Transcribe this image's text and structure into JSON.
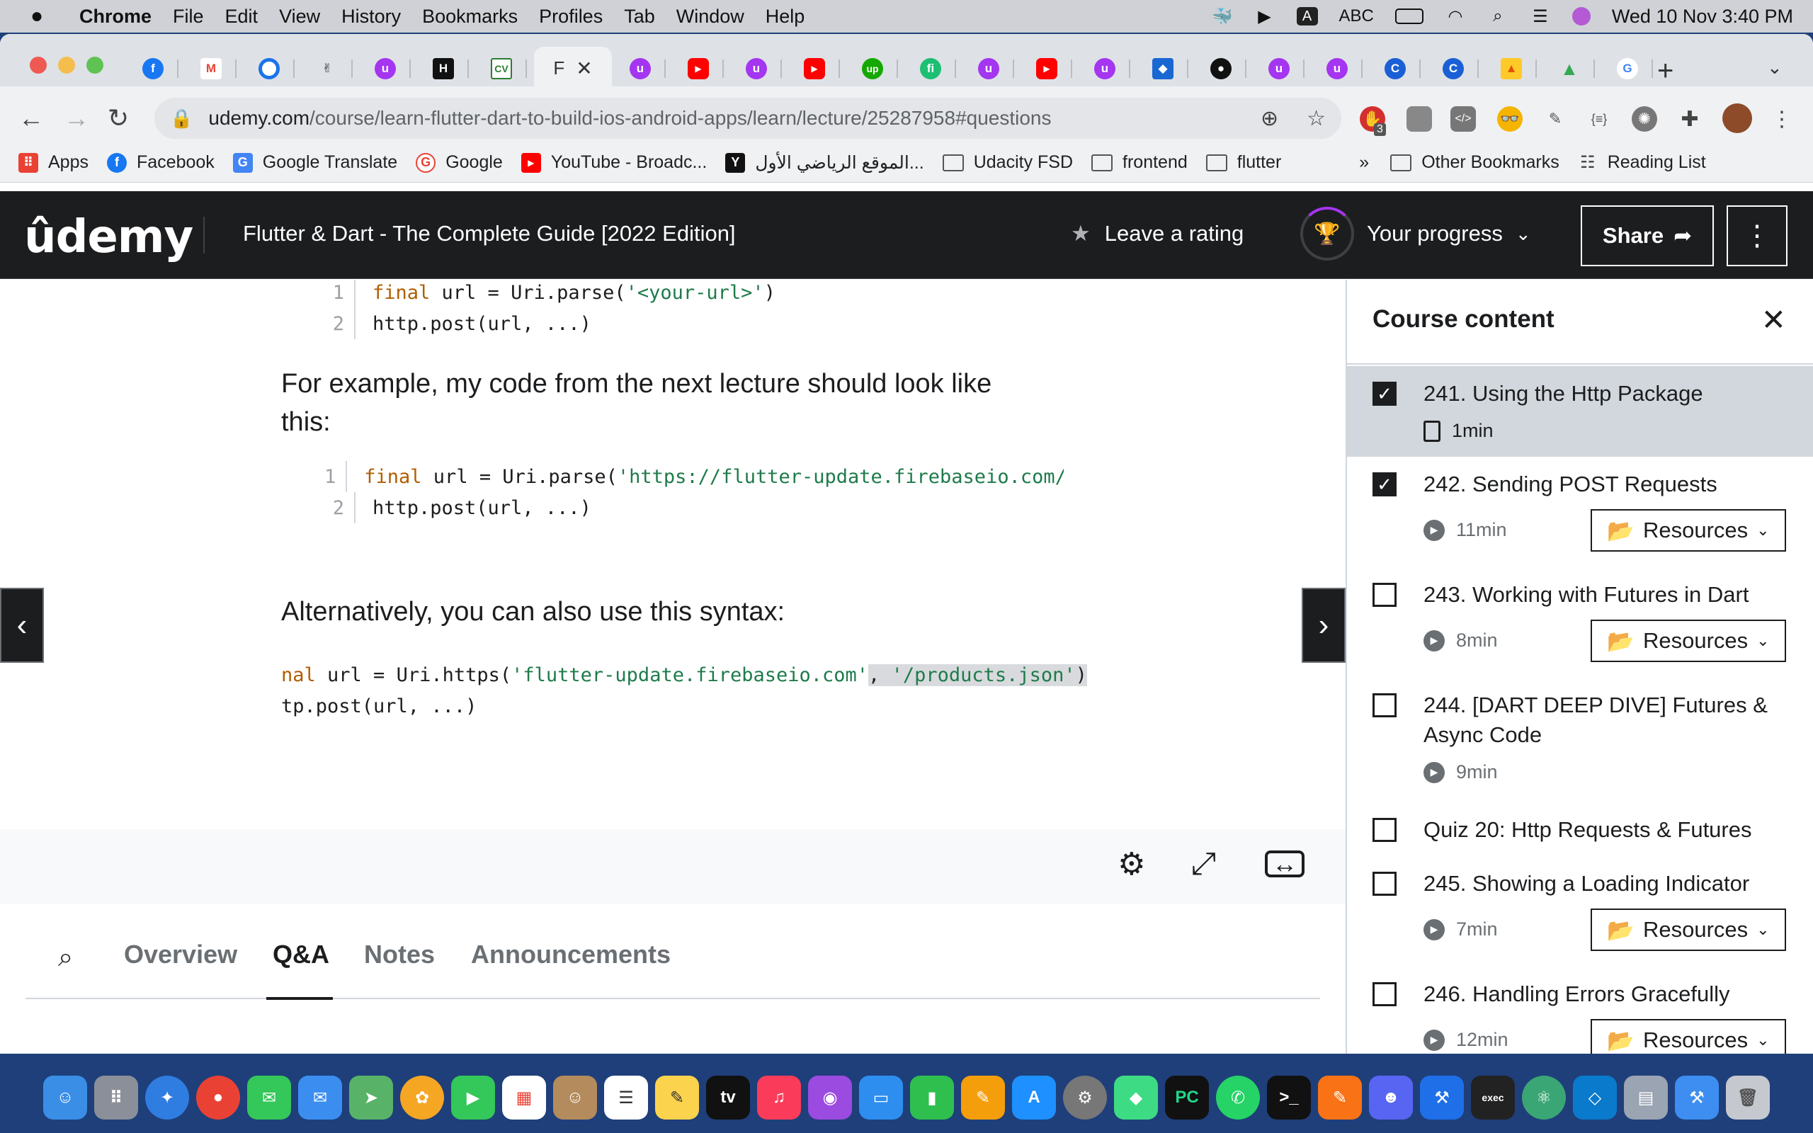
{
  "menubar": {
    "app": "Chrome",
    "items": [
      "File",
      "Edit",
      "View",
      "History",
      "Bookmarks",
      "Profiles",
      "Tab",
      "Window",
      "Help"
    ],
    "input_source": "ABC",
    "datetime": "Wed 10 Nov  3:40 PM"
  },
  "browser": {
    "active_tab_letter": "F",
    "url_host": "udemy.com",
    "url_path": "/course/learn-flutter-dart-to-build-ios-android-apps/learn/lecture/25287958#questions",
    "ext_badge": "3",
    "bookmarks": [
      {
        "label": "Apps",
        "icon": "apps-grid-icon",
        "color": "#e94235"
      },
      {
        "label": "Facebook",
        "icon": "facebook-icon",
        "color": "#1877f2"
      },
      {
        "label": "Google Translate",
        "icon": "google-translate-icon",
        "color": "#4285f4"
      },
      {
        "label": "Google",
        "icon": "google-icon",
        "color": "#ea4335"
      },
      {
        "label": "YouTube - Broadc...",
        "icon": "youtube-icon",
        "color": "#ff0000"
      },
      {
        "label": "الموقع الرياضي الأول...",
        "icon": "yallakora-icon",
        "color": "#111111"
      },
      {
        "label": "Udacity FSD",
        "icon": "folder-icon",
        "color": ""
      },
      {
        "label": "frontend",
        "icon": "folder-icon",
        "color": ""
      },
      {
        "label": "flutter",
        "icon": "folder-icon",
        "color": ""
      }
    ],
    "bookmarks_overflow": "»",
    "other_bookmarks": "Other Bookmarks",
    "reading_list": "Reading List"
  },
  "udemy": {
    "logo": "ûdemy",
    "course_title": "Flutter & Dart - The Complete Guide [2022 Edition]",
    "leave_rating": "Leave a rating",
    "your_progress": "Your progress",
    "share": "Share"
  },
  "lecture": {
    "code1": [
      {
        "n": "1",
        "kw": "final",
        "rest": " url = Uri.parse(",
        "str": "'<your-url>'",
        "end": ")"
      },
      {
        "n": "2",
        "kw": "",
        "rest": "http.post(url, ...)",
        "str": "",
        "end": ""
      }
    ],
    "para1": "For example, my code from the next lecture should look like this:",
    "code2": [
      {
        "n": "1",
        "kw": "final",
        "rest": " url = Uri.parse(",
        "str": "'https://flutter-update.firebaseio.com/",
        "end": ""
      },
      {
        "n": "2",
        "kw": "",
        "rest": "http.post(url, ...)",
        "str": "",
        "end": ""
      }
    ],
    "para2": "Alternatively, you can also use this syntax:",
    "code3": [
      {
        "kw": "nal",
        "rest": " url = Uri.https(",
        "str": "'flutter-update.firebaseio.com'",
        "mid": ", ",
        "str2": "'/products.json'",
        "end": ")"
      },
      {
        "kw": "",
        "rest": "tp.post(url, ...)",
        "str": "",
        "mid": "",
        "str2": "",
        "end": ""
      }
    ]
  },
  "content_tabs": {
    "overview": "Overview",
    "qa": "Q&A",
    "notes": "Notes",
    "announcements": "Announcements"
  },
  "sidebar": {
    "title": "Course content",
    "resources_label": "Resources",
    "items": [
      {
        "title": "241. Using the Http Package",
        "meta": "1min",
        "checked": true,
        "type": "doc",
        "resources": false
      },
      {
        "title": "242. Sending POST Requests",
        "meta": "11min",
        "checked": true,
        "type": "video",
        "resources": true
      },
      {
        "title": "243. Working with Futures in Dart",
        "meta": "8min",
        "checked": false,
        "type": "video",
        "resources": true
      },
      {
        "title": "244. [DART DEEP DIVE] Futures & Async Code",
        "meta": "9min",
        "checked": false,
        "type": "video",
        "resources": false
      },
      {
        "title": "Quiz 20: Http Requests & Futures",
        "meta": "",
        "checked": false,
        "type": "quiz",
        "resources": false
      },
      {
        "title": "245. Showing a Loading Indicator",
        "meta": "7min",
        "checked": false,
        "type": "video",
        "resources": true
      },
      {
        "title": "246. Handling Errors Gracefully",
        "meta": "12min",
        "checked": false,
        "type": "video",
        "resources": true
      }
    ]
  }
}
